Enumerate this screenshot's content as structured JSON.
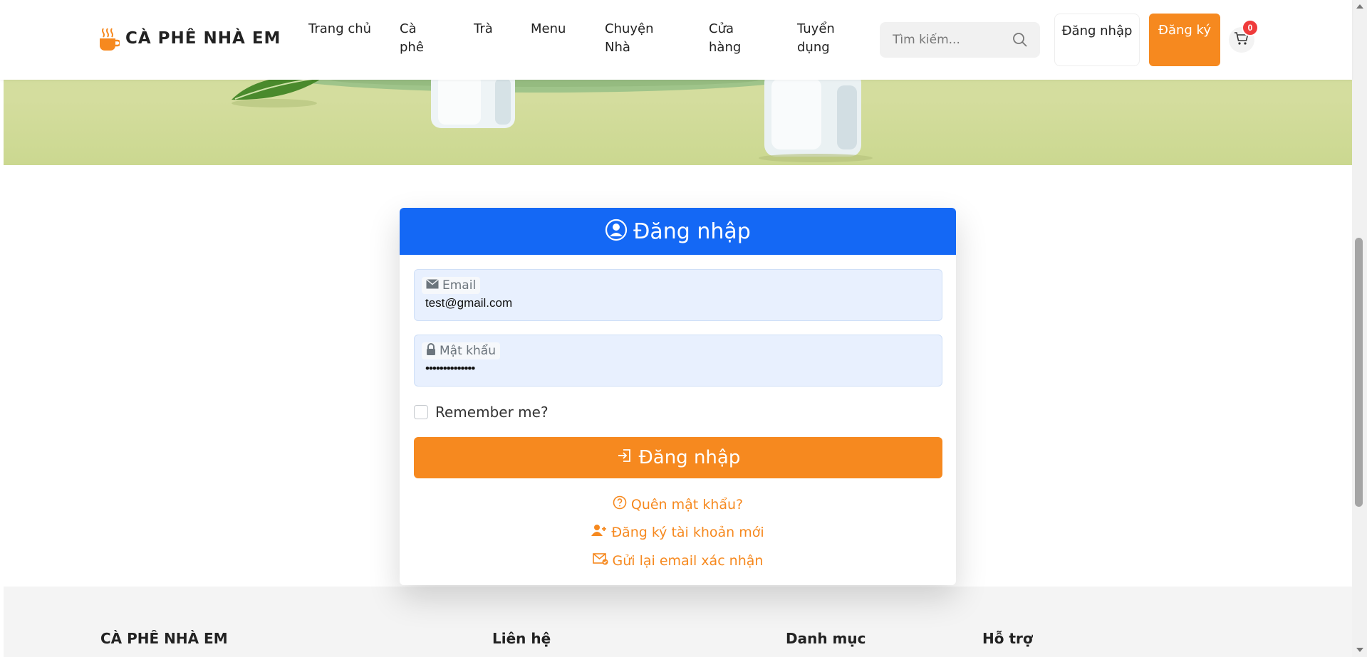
{
  "header": {
    "brand": "CÀ PHÊ NHÀ EM",
    "nav": [
      {
        "label": "Trang chủ"
      },
      {
        "label": "Cà phê"
      },
      {
        "label": "Trà"
      },
      {
        "label": "Menu"
      },
      {
        "label": "Chuyện Nhà"
      },
      {
        "label": "Cửa hàng"
      },
      {
        "label": "Tuyển dụng"
      }
    ],
    "search_placeholder": "Tìm kiếm...",
    "login_label": "Đăng nhập",
    "register_label": "Đăng ký",
    "cart_count": "0"
  },
  "login": {
    "title": "Đăng nhập",
    "email_label": "Email",
    "email_value": "test@gmail.com",
    "password_label": "Mật khẩu",
    "password_value": "••••••••••••••",
    "remember_label": "Remember me?",
    "remember_checked": false,
    "submit_label": "Đăng nhập",
    "forgot_label": "Quên mật khẩu?",
    "register_link_label": "Đăng ký tài khoản mới",
    "resend_label": "Gửi lại email xác nhận"
  },
  "footer": {
    "columns": [
      {
        "title": "CÀ PHÊ NHÀ EM"
      },
      {
        "title": "Liên hệ"
      },
      {
        "title": "Danh mục"
      },
      {
        "title": "Hỗ trợ"
      }
    ]
  },
  "colors": {
    "primary_blue": "#1468f5",
    "accent_orange": "#f6891f",
    "badge_red": "#ef3b3b",
    "banner_green": "#d4dd9e",
    "input_bg": "#e8f0fe"
  },
  "icons": {
    "brand": "coffee-cup-icon",
    "search": "search-icon",
    "cart": "cart-icon",
    "title": "user-circle-icon",
    "email": "envelope-icon",
    "password": "lock-icon",
    "submit": "login-arrow-icon",
    "forgot": "question-circle-icon",
    "register": "user-plus-icon",
    "resend": "envelope-check-icon"
  }
}
